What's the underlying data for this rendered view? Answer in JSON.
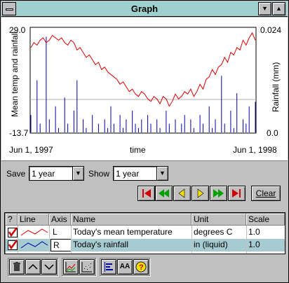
{
  "window": {
    "title": "Graph",
    "minimize_glyph": "▼",
    "maximize_glyph": "▲"
  },
  "chart_data": {
    "type": "line",
    "title": "",
    "x_start_label": "Jun 1, 1997",
    "x_end_label": "Jun 1, 1998",
    "xlabel": "time",
    "ylabel_left": "Mean temp and rainfall",
    "ylabel_right": "Rainfall (mm)",
    "left_axis": {
      "min": -13.7,
      "max": 29.0,
      "min_label": "-13.7",
      "max_label": "29.0"
    },
    "right_axis": {
      "min": 0.0,
      "max": 0.024,
      "min_label": "0.0",
      "max_label": "0.024"
    },
    "grid": false,
    "series": [
      {
        "name": "Today's mean temperature",
        "axis": "L",
        "color": "#e00000",
        "values": [
          21,
          23,
          22,
          24,
          25,
          23,
          24,
          26,
          25,
          24,
          25,
          23,
          22,
          24,
          23,
          20,
          21,
          19,
          17,
          18,
          16,
          14,
          15,
          12,
          13,
          11,
          10,
          9,
          8,
          6,
          7,
          5,
          3,
          4,
          2,
          1,
          3,
          2,
          0,
          -1,
          1,
          0,
          -2,
          1,
          0,
          -3,
          -1,
          2,
          0,
          1,
          3,
          2,
          4,
          1,
          3,
          6,
          4,
          8,
          9,
          12,
          10,
          13,
          14,
          17,
          15,
          19,
          18,
          21,
          20,
          24,
          22,
          25,
          27,
          24
        ]
      },
      {
        "name": "Today's rainfall",
        "axis": "R",
        "color": "#0000a8",
        "values": [
          0.004,
          0.0,
          0.012,
          0.002,
          0.0,
          0.022,
          0.003,
          0.0,
          0.006,
          0.001,
          0.0,
          0.008,
          0.002,
          0.0,
          0.005,
          0.012,
          0.0,
          0.003,
          0.001,
          0.0,
          0.004,
          0.0,
          0.002,
          0.0,
          0.003,
          0.001,
          0.006,
          0.002,
          0.0,
          0.004,
          0.001,
          0.003,
          0.0,
          0.005,
          0.002,
          0.001,
          0.003,
          0.0,
          0.004,
          0.002,
          0.0,
          0.003,
          0.001,
          0.0,
          0.005,
          0.002,
          0.0,
          0.003,
          0.0,
          0.002,
          0.004,
          0.0,
          0.003,
          0.001,
          0.0,
          0.004,
          0.002,
          0.0,
          0.006,
          0.001,
          0.003,
          0.0,
          0.013,
          0.002,
          0.0,
          0.005,
          0.001,
          0.009,
          0.0,
          0.003,
          0.002,
          0.006,
          0.0,
          0.007
        ]
      }
    ]
  },
  "controls": {
    "save_label": "Save",
    "save_value": "1 year",
    "show_label": "Show",
    "show_value": "1 year",
    "clear_label": "Clear"
  },
  "table": {
    "headers": {
      "check": "?",
      "line": "Line",
      "axis": "Axis",
      "name": "Name",
      "unit": "Unit",
      "scale": "Scale"
    },
    "rows": [
      {
        "axis": "L",
        "name": "Today's mean temperature",
        "unit": "degrees C",
        "scale": "1.0",
        "line_color": "#e00000"
      },
      {
        "axis": "R",
        "name": "Today's rainfall",
        "unit": "in (liquid)",
        "scale": "1.0",
        "line_color": "#0000a8"
      }
    ]
  },
  "toolbar": {
    "font_label": "AA",
    "help_label": "?"
  }
}
